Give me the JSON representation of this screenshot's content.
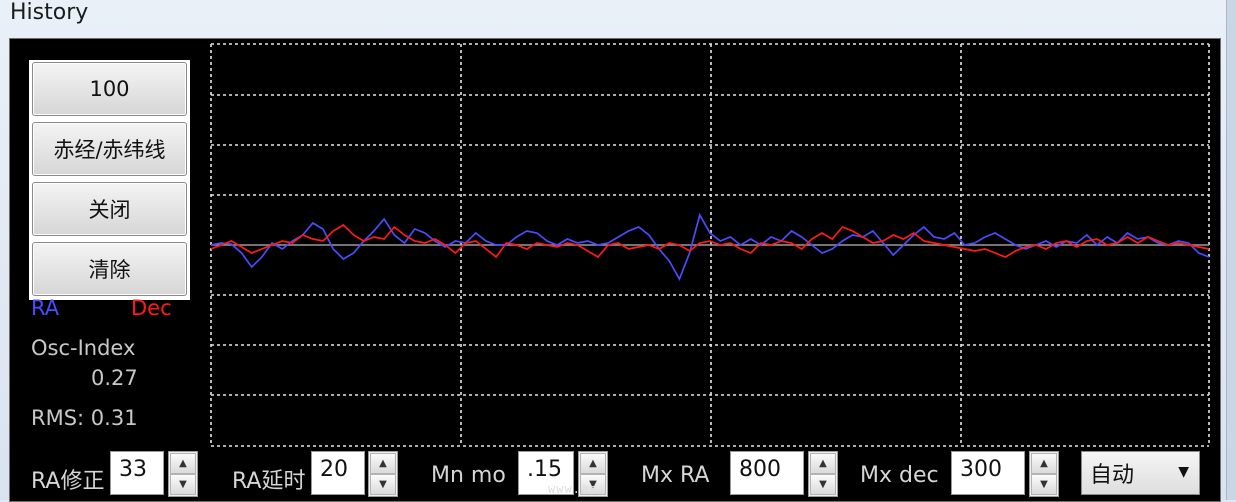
{
  "window": {
    "title": "History"
  },
  "buttons": [
    {
      "label": "100"
    },
    {
      "label": "赤经/赤纬线"
    },
    {
      "label": "关闭"
    },
    {
      "label": "清除"
    }
  ],
  "legend": {
    "ra": "RA",
    "dec": "Dec"
  },
  "stats": {
    "osc_label": "Osc-Index",
    "osc_value": "0.27",
    "rms": "RMS: 0.31"
  },
  "controls": {
    "ra_correction": {
      "label": "RA修正",
      "value": "33"
    },
    "ra_delay": {
      "label": "RA延时",
      "value": "20"
    },
    "min_move": {
      "label": "Mn mo",
      "value": ".15"
    },
    "max_ra": {
      "label": "Mx RA",
      "value": "800"
    },
    "max_dec": {
      "label": "Mx dec",
      "value": "300"
    },
    "mode": {
      "value": "自动"
    }
  },
  "watermark": "www.as",
  "colors": {
    "ra": "#4b4bff",
    "dec": "#ff1a1a",
    "grid": "#e6e6e6",
    "zero": "#9a9a9a"
  },
  "chart_data": {
    "type": "line",
    "series": [
      {
        "name": "RA",
        "values": [
          0.0,
          0.05,
          0.02,
          -0.2,
          -0.55,
          -0.3,
          0.05,
          -0.1,
          0.1,
          0.25,
          0.55,
          0.4,
          -0.1,
          -0.35,
          -0.2,
          0.1,
          0.35,
          0.65,
          0.25,
          0.05,
          0.4,
          0.3,
          0.1,
          -0.05,
          0.1,
          0.05,
          0.3,
          0.1,
          0.0,
          0.0,
          0.2,
          0.35,
          0.3,
          0.1,
          0.0,
          0.15,
          0.05,
          0.1,
          0.0,
          0.05,
          0.2,
          0.35,
          0.45,
          0.25,
          -0.1,
          -0.4,
          -0.85,
          -0.2,
          0.75,
          0.3,
          0.1,
          0.2,
          0.0,
          0.15,
          0.0,
          0.2,
          0.1,
          0.35,
          0.2,
          0.0,
          -0.2,
          -0.1,
          0.1,
          0.25,
          0.2,
          0.35,
          0.05,
          -0.25,
          0.0,
          0.25,
          0.45,
          0.2,
          0.15,
          0.3,
          0.0,
          0.05,
          0.2,
          0.3,
          0.15,
          0.0,
          -0.1,
          0.0,
          0.1,
          -0.05,
          0.1,
          0.05,
          0.25,
          0.0,
          0.2,
          0.05,
          0.3,
          0.15,
          0.2,
          0.05,
          0.0,
          0.1,
          0.05,
          -0.2,
          -0.3
        ]
      },
      {
        "name": "Dec",
        "values": [
          -0.1,
          0.0,
          0.1,
          -0.05,
          -0.2,
          -0.1,
          0.0,
          0.1,
          0.05,
          0.25,
          0.15,
          0.1,
          0.35,
          0.5,
          0.25,
          0.1,
          0.2,
          0.15,
          0.45,
          0.25,
          0.1,
          0.05,
          0.15,
          0.0,
          -0.2,
          0.05,
          0.1,
          -0.1,
          -0.3,
          0.05,
          0.0,
          -0.1,
          0.05,
          0.0,
          -0.05,
          0.05,
          0.0,
          -0.15,
          -0.3,
          0.0,
          0.05,
          -0.1,
          -0.05,
          0.0,
          -0.1,
          0.05,
          0.0,
          -0.15,
          0.05,
          0.1,
          0.0,
          0.05,
          -0.1,
          -0.2,
          0.05,
          0.0,
          0.1,
          0.05,
          -0.1,
          0.15,
          0.3,
          0.15,
          0.45,
          0.35,
          0.2,
          0.05,
          0.1,
          0.25,
          0.15,
          0.3,
          0.1,
          0.05,
          0.0,
          -0.05,
          -0.1,
          -0.15,
          -0.1,
          -0.2,
          -0.3,
          -0.15,
          -0.05,
          0.0,
          -0.1,
          0.05,
          0.1,
          -0.05,
          0.1,
          0.15,
          0.0,
          0.05,
          0.2,
          0.05,
          0.2,
          0.1,
          0.0,
          0.05,
          0.0,
          -0.05,
          -0.1
        ]
      }
    ],
    "ylim": [
      -2.5,
      2.5
    ],
    "grid": true
  }
}
